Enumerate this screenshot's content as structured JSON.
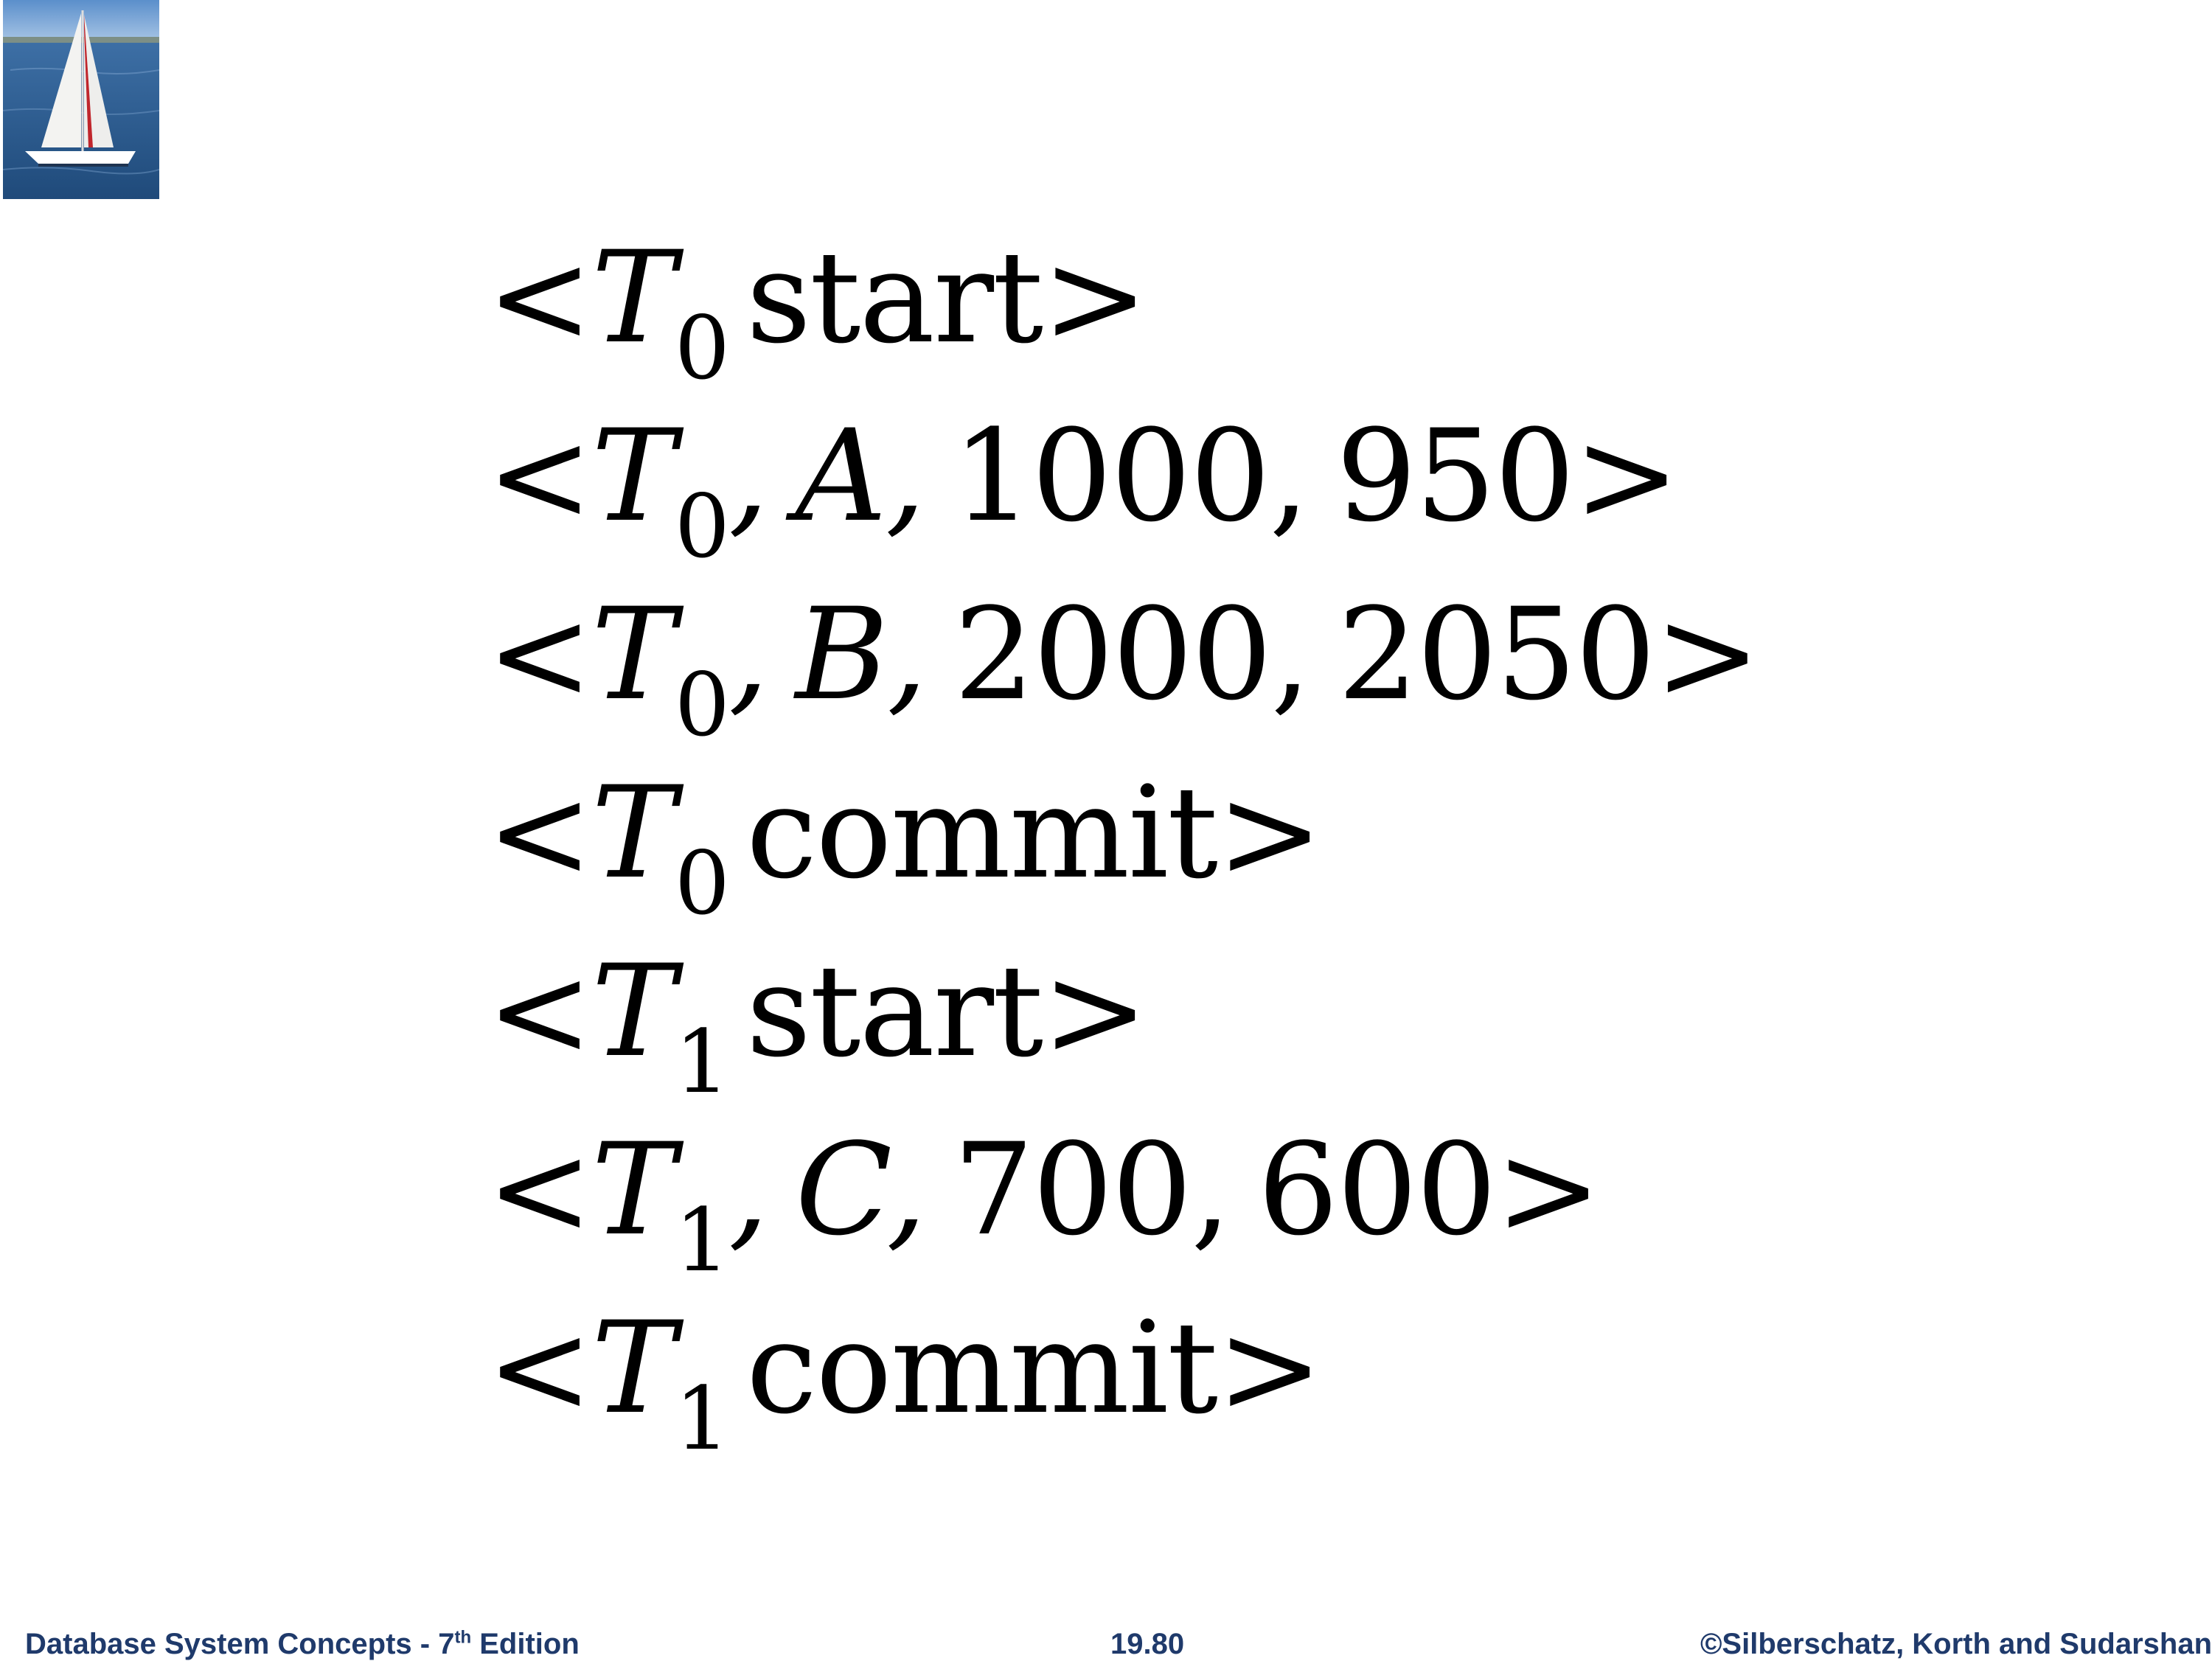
{
  "slide": {
    "log_records": [
      {
        "txn": "T",
        "sub": "0",
        "sep": "",
        "fields": [],
        "action": "start"
      },
      {
        "txn": "T",
        "sub": "0",
        "sep": ",",
        "fields": [
          "A,",
          "1000,",
          "950"
        ],
        "action": ""
      },
      {
        "txn": "T",
        "sub": "0",
        "sep": ",",
        "fields": [
          "B,",
          "2000,",
          "2050"
        ],
        "action": ""
      },
      {
        "txn": "T",
        "sub": "0",
        "sep": "",
        "fields": [],
        "action": "commit"
      },
      {
        "txn": "T",
        "sub": "1",
        "sep": "",
        "fields": [],
        "action": "start"
      },
      {
        "txn": "T",
        "sub": "1",
        "sep": ",",
        "fields": [
          "C,",
          "700,",
          "600"
        ],
        "action": ""
      },
      {
        "txn": "T",
        "sub": "1",
        "sep": "",
        "fields": [],
        "action": "commit"
      }
    ],
    "open_bracket": "<",
    "close_bracket": ">"
  },
  "footer": {
    "left_text": "Database System Concepts - 7",
    "left_sup": "th",
    "left_suffix": " Edition",
    "page_number": "19.80",
    "copyright": "©Silberschatz, Korth and Sudarshan"
  },
  "logo": {
    "icon": "sailboat-logo-icon",
    "sky": "#6f9fd2",
    "sea": "#2d5f93",
    "sail": "#f4f4f2",
    "sail_stripe": "#c0262c"
  }
}
